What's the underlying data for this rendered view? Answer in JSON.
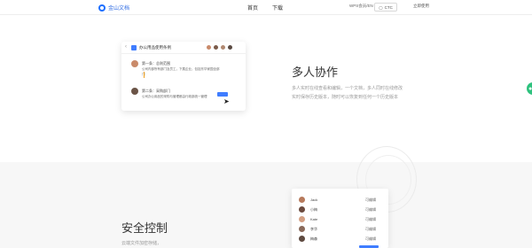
{
  "header": {
    "brand": "金山文档",
    "nav": [
      "首页",
      "下载"
    ],
    "lang": "WPS会员/EN",
    "login": "CTC",
    "register": "立即使用"
  },
  "card": {
    "title": "办公用品使用条例",
    "entries": [
      {
        "title": "第一条：总则范围",
        "lines": [
          "公司内部所有部门及员工，下属企业，包括东华家园全部",
          "门"
        ]
      },
      {
        "title": "第二条：采购部门",
        "lines": [
          "公司办公用品的采购与管理都由行政部统一管理"
        ]
      }
    ]
  },
  "feature1": {
    "headline": "多人协作",
    "lines": [
      "多人实时在线查看和编辑，一个文档，多人同时在线修改",
      "实时保存历史版本，随时可以恢复到任何一个历史版本"
    ]
  },
  "feature2": {
    "headline": "安全控制",
    "line": "云端文件加密存储，"
  },
  "permissions": [
    {
      "name": "Jack",
      "role": "可编辑"
    },
    {
      "name": "小梅",
      "role": "可编辑"
    },
    {
      "name": "Kate",
      "role": "可编辑"
    },
    {
      "name": "李华",
      "role": "可编辑"
    },
    {
      "name": "梅森",
      "role": "可编辑"
    }
  ],
  "colors": {
    "accent": "#3f7dff",
    "brand": "#2d6ae3",
    "fab": "#2ec27e"
  }
}
